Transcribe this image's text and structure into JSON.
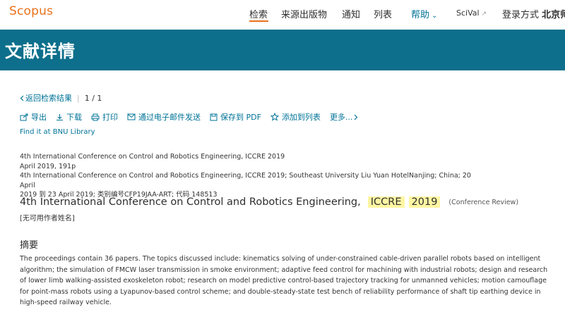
{
  "brand": {
    "logo": "Scopus"
  },
  "nav": {
    "search": "检索",
    "sources": "来源出版物",
    "alerts": "通知",
    "lists": "列表",
    "help": "帮助",
    "scival": "SciVal",
    "login": "登录方式",
    "institution": "北京师"
  },
  "banner": {
    "title": "文献详情"
  },
  "results_nav": {
    "back": "返回检索结果",
    "pager": "1 / 1"
  },
  "actions": {
    "export": "导出",
    "download": "下载",
    "print": "打印",
    "email": "通过电子邮件发送",
    "save_pdf": "保存到 PDF",
    "add_list": "添加到列表",
    "more": "更多..."
  },
  "findit": "Find it at BNU Library",
  "source": {
    "line1": "4th International Conference on Control and Robotics Engineering, ICCRE 2019",
    "line2": "April 2019, 191p",
    "line3": "4th International Conference on Control and Robotics Engineering, ICCRE 2019; Southeast University Liu Yuan HotelNanjing; China; 20 April",
    "line4": "2019 到 23 April 2019; 类别编号CFP19JAA-ART; 代码 148513"
  },
  "document": {
    "title_main": "4th International Conference on Control and Robotics Engineering,",
    "title_hl1": "ICCRE",
    "title_hl2": "2019",
    "doc_type": "(Conference Review)",
    "authors": "[无可用作者姓名]"
  },
  "abstract": {
    "heading": "摘要",
    "text": "The proceedings contain 36 papers. The topics discussed include: kinematics solving of under-constrained cable-driven parallel robots based on intelligent algorithm; the simulation of FMCW laser transmission in smoke environment; adaptive feed control for machining with industrial robots; design and research of lower limb walking-assisted exoskeleton robot; research on model predictive control-based trajectory tracking for unmanned vehicles; motion camouflage for point-mass robots using a Lyapunov-based control scheme; and double-steady-state test bench of reliability performance of shaft tip earthing device in high-speed railway vehicle."
  },
  "colors": {
    "brand_orange": "#e9711c",
    "banner_teal": "#0d6f8c",
    "link_blue": "#007398",
    "highlight": "#fff6a3"
  },
  "icons": [
    "export-icon",
    "download-icon",
    "print-icon",
    "email-icon",
    "save-pdf-icon",
    "star-icon",
    "chevron-right-icon",
    "chevron-left-icon",
    "chevron-down-icon",
    "external-link-icon"
  ]
}
